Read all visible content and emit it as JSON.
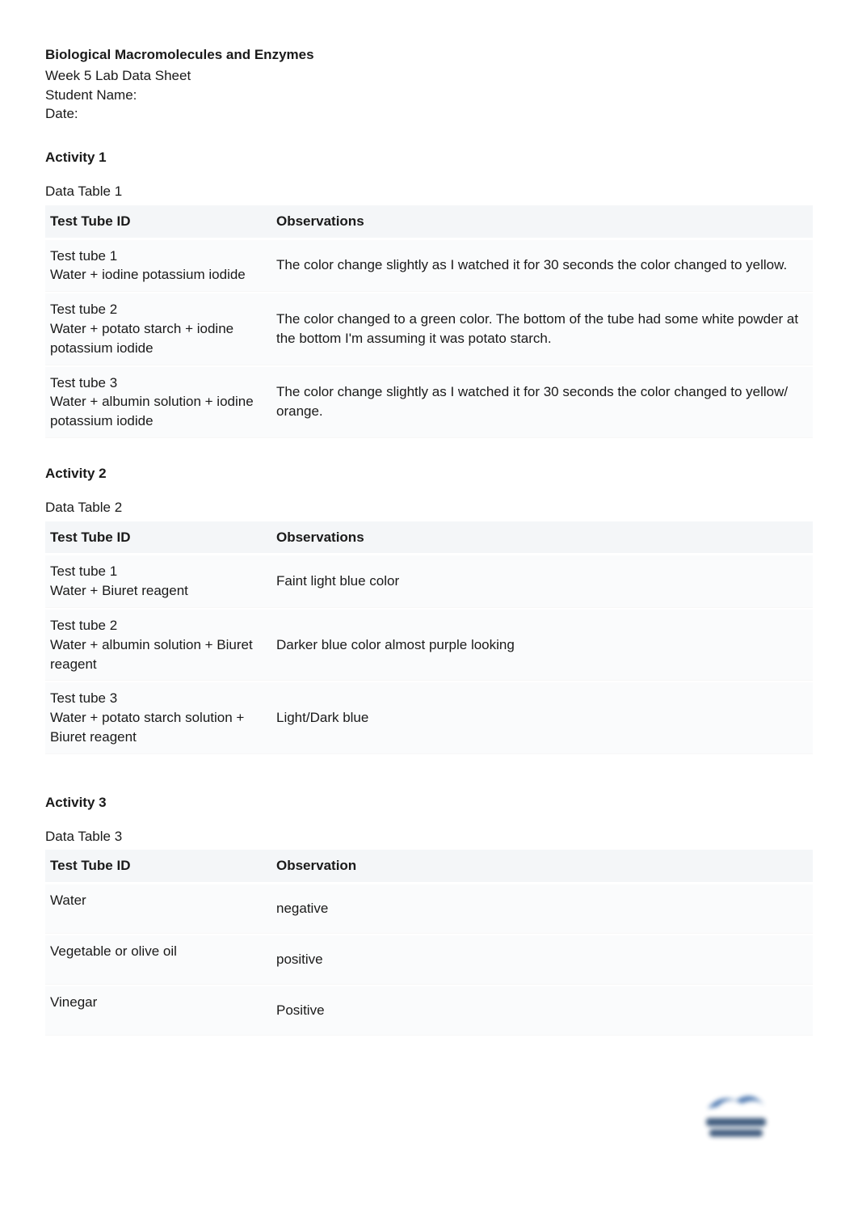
{
  "header": {
    "title": "Biological Macromolecules and Enzymes",
    "subtitle": "Week 5 Lab Data Sheet",
    "student_name_label": "Student Name:",
    "date_label": "Date:"
  },
  "activity1": {
    "heading": "Activity 1",
    "caption": "Data Table 1",
    "columns": {
      "id": "Test Tube ID",
      "obs": "Observations"
    },
    "rows": [
      {
        "id": "Test tube 1\nWater + iodine potassium iodide",
        "obs": "The color change slightly as I watched it for 30 seconds the color changed to yellow."
      },
      {
        "id": "Test tube 2\nWater + potato starch + iodine potassium iodide",
        "obs": "The color changed to a green color. The bottom of the tube had some white powder at the bottom I'm assuming it was potato starch."
      },
      {
        "id": "Test tube 3\nWater + albumin solution + iodine potassium iodide",
        "obs": "The color change slightly as I watched it for 30 seconds the color changed to yellow/ orange."
      }
    ]
  },
  "activity2": {
    "heading": "Activity 2",
    "caption": "Data Table 2",
    "columns": {
      "id": "Test Tube ID",
      "obs": "Observations"
    },
    "rows": [
      {
        "id": "Test tube 1\nWater + Biuret reagent",
        "obs": "Faint light blue color"
      },
      {
        "id": "Test tube 2\nWater + albumin solution + Biuret reagent",
        "obs": "Darker blue color almost purple looking"
      },
      {
        "id": "Test tube 3\nWater + potato starch solution + Biuret reagent",
        "obs": "Light/Dark blue"
      }
    ]
  },
  "activity3": {
    "heading": "Activity 3",
    "caption": "Data Table 3",
    "columns": {
      "id": "Test Tube ID",
      "obs": "Observation"
    },
    "rows": [
      {
        "id": "Water",
        "obs": "negative"
      },
      {
        "id": "Vegetable or olive oil",
        "obs": "positive"
      },
      {
        "id": "Vinegar",
        "obs": "Positive"
      }
    ]
  }
}
